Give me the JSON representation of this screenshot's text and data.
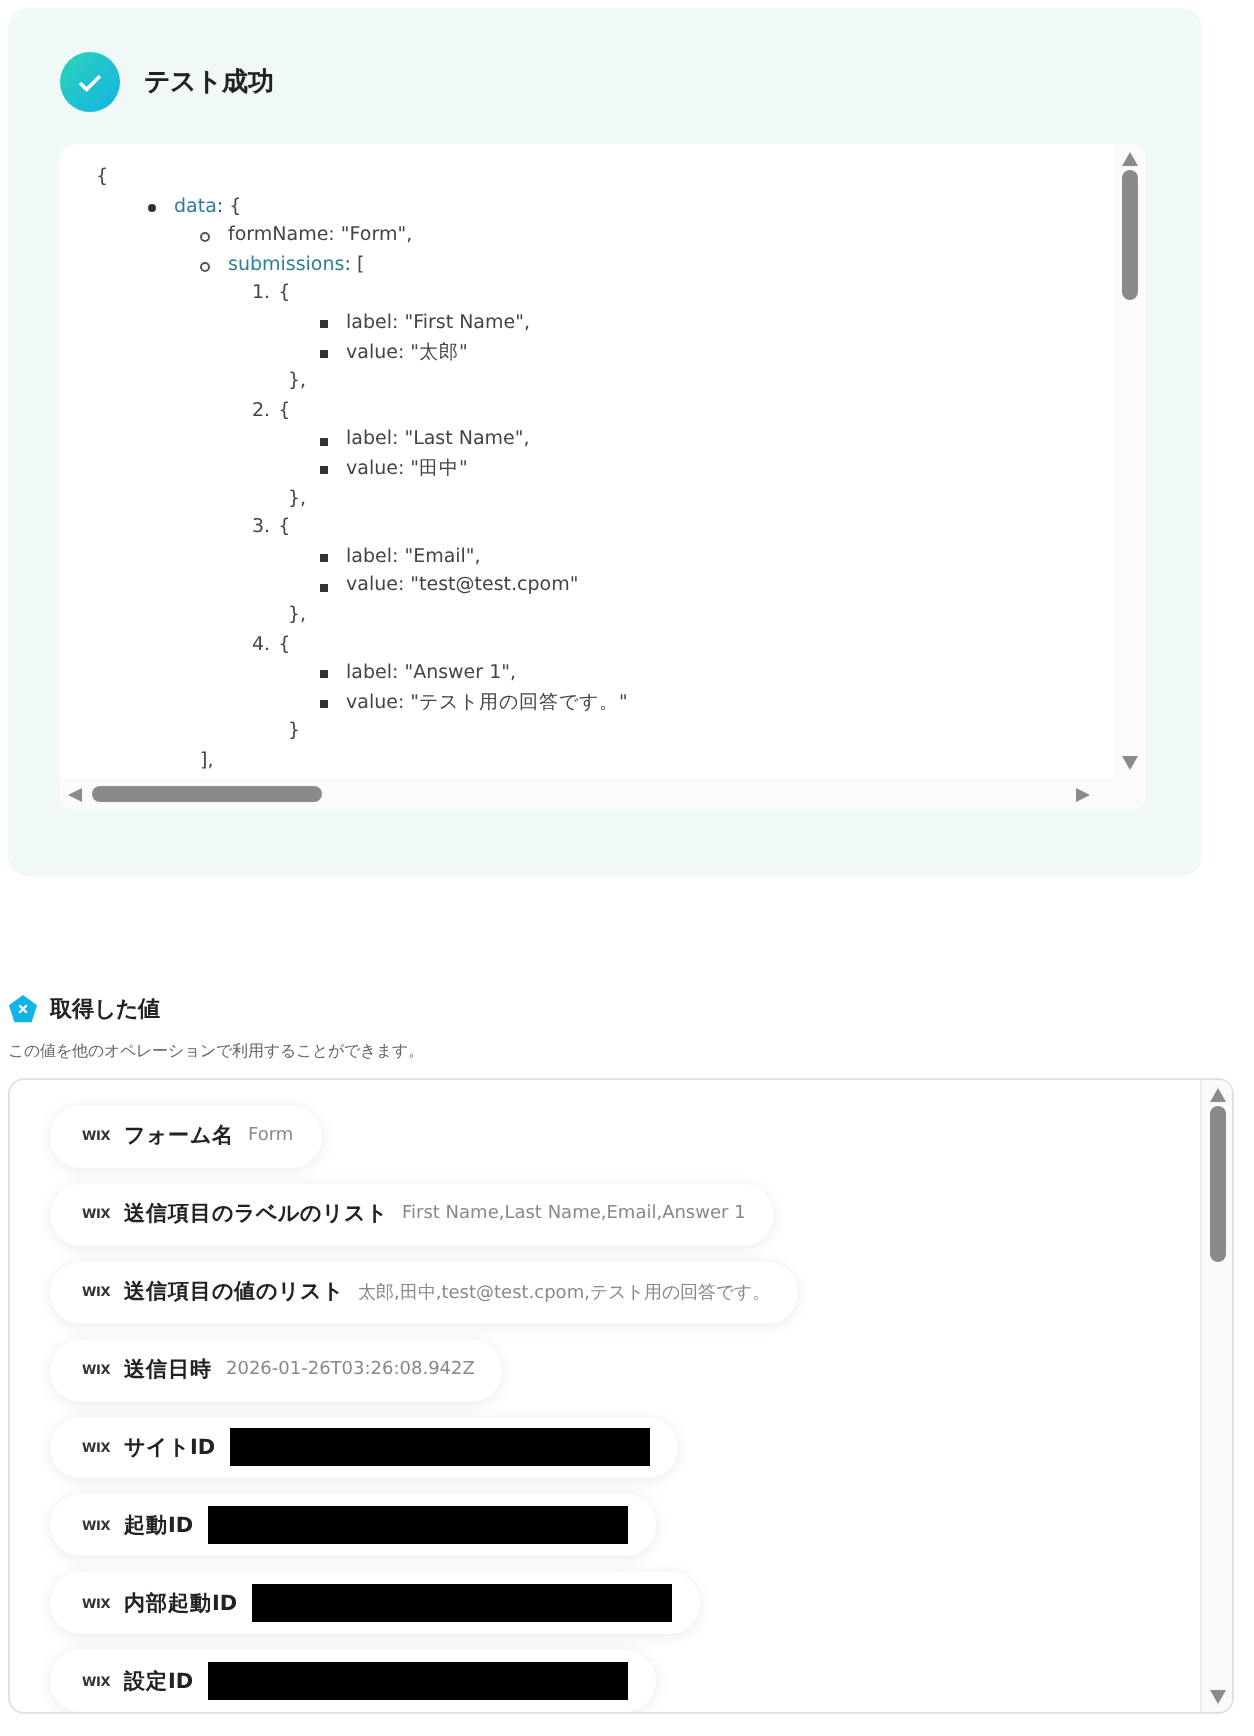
{
  "test_result": {
    "title": "テスト成功",
    "success": true,
    "json_view": {
      "open": "{",
      "nodes": [
        {
          "kind": "disc",
          "key": "data",
          "text": ": {",
          "children": [
            {
              "kind": "circle",
              "text": "formName: \"Form\","
            },
            {
              "kind": "circle",
              "key": "submissions",
              "text": ": [",
              "close": "],",
              "children": [
                {
                  "kind": "number",
                  "number": "1.",
                  "text": "{",
                  "close": "},",
                  "children": [
                    {
                      "kind": "square",
                      "text": "label: \"First Name\","
                    },
                    {
                      "kind": "square",
                      "text": "value: \"太郎\""
                    }
                  ]
                },
                {
                  "kind": "number",
                  "number": "2.",
                  "text": "{",
                  "close": "},",
                  "children": [
                    {
                      "kind": "square",
                      "text": "label: \"Last Name\","
                    },
                    {
                      "kind": "square",
                      "text": "value: \"田中\""
                    }
                  ]
                },
                {
                  "kind": "number",
                  "number": "3.",
                  "text": "{",
                  "close": "},",
                  "children": [
                    {
                      "kind": "square",
                      "text": "label: \"Email\","
                    },
                    {
                      "kind": "square",
                      "text": "value: \"test@test.cpom\""
                    }
                  ]
                },
                {
                  "kind": "number",
                  "number": "4.",
                  "text": "{",
                  "close": "}",
                  "children": [
                    {
                      "kind": "square",
                      "text": "label: \"Answer 1\","
                    },
                    {
                      "kind": "square",
                      "text": "value: \"テスト用の回答です。\""
                    }
                  ]
                }
              ]
            }
          ]
        }
      ]
    }
  },
  "values": {
    "title": "取得した値",
    "description": "この値を他のオペレーションで利用することができます。",
    "items": [
      {
        "logo": "WIX",
        "label": "フォーム名",
        "value": "Form",
        "redacted": false
      },
      {
        "logo": "WIX",
        "label": "送信項目のラベルのリスト",
        "value": "First Name,Last Name,Email,Answer 1",
        "redacted": false
      },
      {
        "logo": "WIX",
        "label": "送信項目の値のリスト",
        "value": "太郎,田中,test@test.cpom,テスト用の回答です。",
        "redacted": false
      },
      {
        "logo": "WIX",
        "label": "送信日時",
        "value": "2026-01-26T03:26:08.942Z",
        "redacted": false
      },
      {
        "logo": "WIX",
        "label": "サイトID",
        "redacted": true
      },
      {
        "logo": "WIX",
        "label": "起動ID",
        "redacted": true
      },
      {
        "logo": "WIX",
        "label": "内部起動ID",
        "redacted": true
      },
      {
        "logo": "WIX",
        "label": "設定ID",
        "redacted": true
      }
    ]
  }
}
